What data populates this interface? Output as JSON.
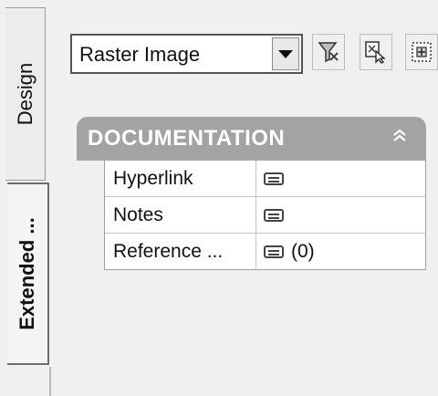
{
  "tabs": {
    "design_label": "Design",
    "extended_label": "Extended ..."
  },
  "toolbar": {
    "type_combo_value": "Raster Image",
    "icons": [
      "filter-icon",
      "select-element-icon",
      "properties-icon"
    ]
  },
  "property_grid": {
    "category_title": "DOCUMENTATION",
    "rows": [
      {
        "name": "Hyperlink",
        "value": ""
      },
      {
        "name": "Notes",
        "value": ""
      },
      {
        "name": "Reference ...",
        "value": "(0)"
      }
    ]
  }
}
